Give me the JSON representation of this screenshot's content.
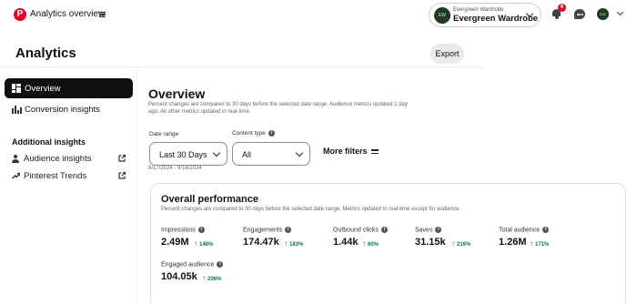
{
  "topbar": {
    "app_title": "Analytics overview",
    "account_sub": "Evergreen Wardrobe",
    "account_name": "Evergreen Wardrobe",
    "notification_count": "6",
    "avatar_initials": "EW"
  },
  "page": {
    "title": "Analytics",
    "export_label": "Export"
  },
  "sidebar": {
    "items": [
      {
        "label": "Overview",
        "active": true
      },
      {
        "label": "Conversion insights",
        "active": false
      }
    ],
    "additional_heading": "Additional insights",
    "additional_items": [
      {
        "label": "Audience insights"
      },
      {
        "label": "Pinterest Trends"
      }
    ]
  },
  "overview": {
    "title": "Overview",
    "description": "Percent changes are compared to 30 days before the selected date range. Audience metrics updated 1 day ago. All other metrics updated in real-time.",
    "date_range_label": "Date range",
    "date_range_value": "Last 30 Days",
    "date_range_text": "8/17/2024 - 9/16/2024",
    "content_type_label": "Content type",
    "content_type_value": "All",
    "more_filters": "More filters"
  },
  "performance": {
    "title": "Overall performance",
    "description": "Percent changes are compared to 30 days before the selected date range. Metrics updated in real-time except for audience.",
    "metrics": [
      {
        "label": "Impressions",
        "value": "2.49M",
        "change": "146%"
      },
      {
        "label": "Engagements",
        "value": "174.47k",
        "change": "183%"
      },
      {
        "label": "Outbound clicks",
        "value": "1.44k",
        "change": "60%"
      },
      {
        "label": "Saves",
        "value": "31.15k",
        "change": "216%"
      },
      {
        "label": "Total audience",
        "value": "1.26M",
        "change": "171%"
      },
      {
        "label": "Engaged audience",
        "value": "104.05k",
        "change": "206%"
      }
    ]
  },
  "colors": {
    "brand": "#e60023",
    "positive": "#0b7a3e",
    "active_nav": "#111111"
  }
}
